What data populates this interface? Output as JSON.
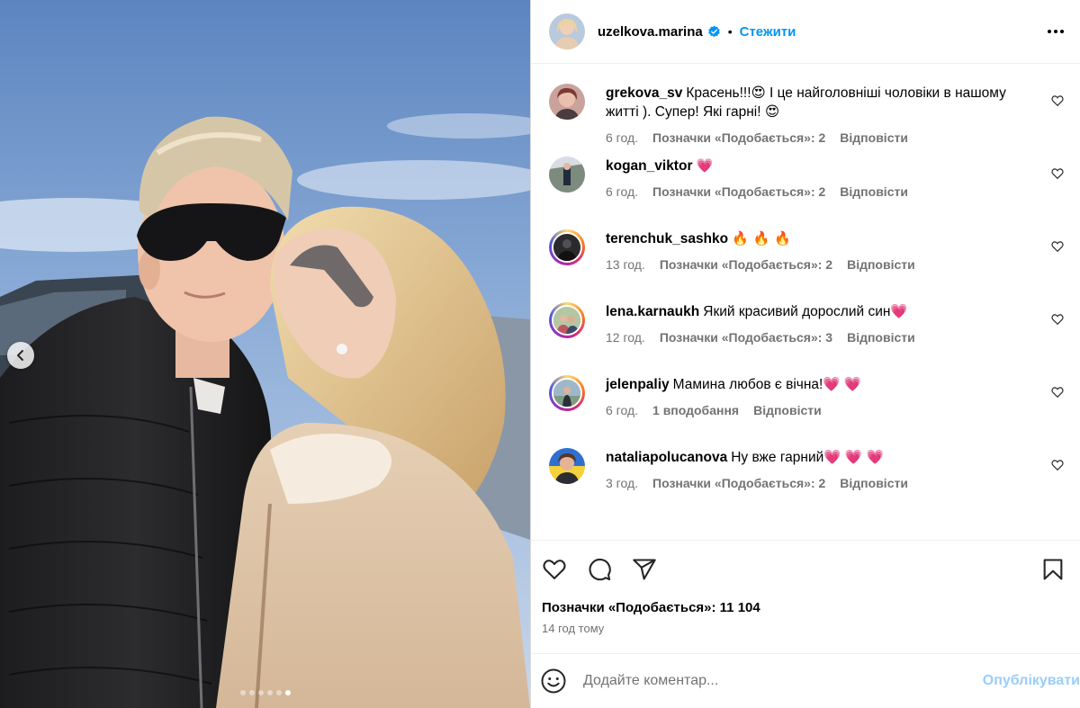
{
  "post": {
    "author": "uzelkova.marina",
    "follow_label": "Стежити",
    "separator": "•",
    "carousel": {
      "count": 6,
      "active": 5
    }
  },
  "comments": [
    {
      "user": "grekova_sv",
      "text": "Красень!!!😍 І це найголовніші чоловіки в нашому житті ). Супер! Які гарні! 😍",
      "time": "6 год.",
      "likes": "Позначки «Подобається»: 2",
      "reply": "Відповісти"
    },
    {
      "user": "kogan_viktor",
      "text": "💗",
      "time": "6 год.",
      "likes": "Позначки «Подобається»: 2",
      "reply": "Відповісти"
    },
    {
      "user": "terenchuk_sashko",
      "text": "🔥 🔥 🔥",
      "time": "13 год.",
      "likes": "Позначки «Подобається»: 2",
      "reply": "Відповісти"
    },
    {
      "user": "lena.karnaukh",
      "text": "Який красивий дорослий син💗",
      "time": "12 год.",
      "likes": "Позначки «Подобається»: 3",
      "reply": "Відповісти"
    },
    {
      "user": "jelenpaliy",
      "text": "Мамина любов є вічна!💗 💗",
      "time": "6 год.",
      "likes": "1 вподобання",
      "reply": "Відповісти"
    },
    {
      "user": "nataliapolucanova",
      "text": "Ну вже гарний💗 💗 💗",
      "time": "3 год.",
      "likes": "Позначки «Подобається»: 2",
      "reply": "Відповісти"
    }
  ],
  "footer": {
    "likes": "Позначки «Подобається»: 11 104",
    "time": "14 год тому"
  },
  "composer": {
    "placeholder": "Додайте коментар...",
    "post_label": "Опублікувати"
  },
  "icons": [
    "chevron-left-icon",
    "more-icon",
    "verified-icon",
    "heart-icon",
    "comment-icon",
    "share-icon",
    "bookmark-icon",
    "emoji-icon"
  ],
  "colors": {
    "link": "#0095f6",
    "muted": "#737373",
    "post_disabled": "#99cdfa",
    "verified": "#0095f6"
  }
}
